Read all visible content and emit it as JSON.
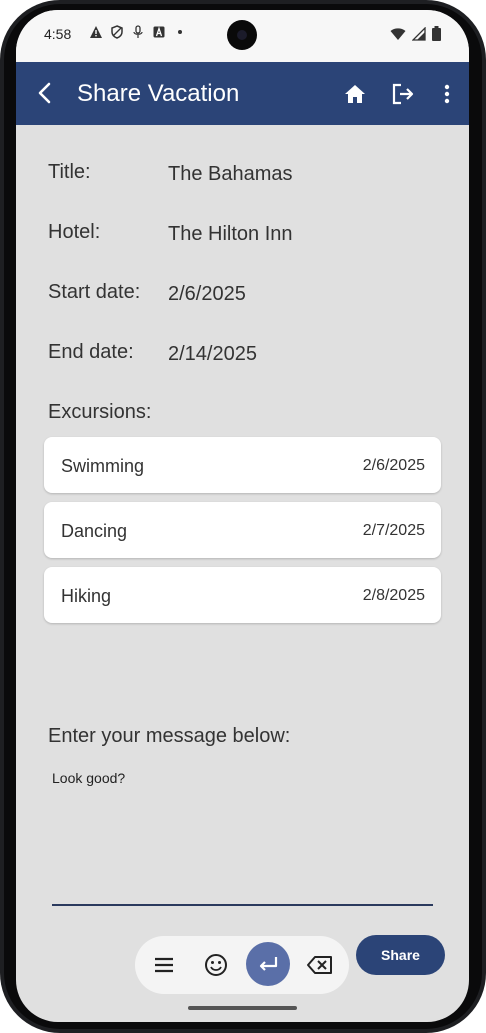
{
  "status_bar": {
    "time": "4:58",
    "left_icons": [
      "warning-icon",
      "shield-icon",
      "mic-icon",
      "a-box-icon",
      "dot-icon"
    ],
    "right_icons": [
      "wifi-icon",
      "signal-icon",
      "battery-icon"
    ]
  },
  "app_bar": {
    "title": "Share Vacation",
    "background": "#2b4477",
    "actions": [
      "home-icon",
      "logout-icon",
      "more-vert-icon"
    ]
  },
  "details": {
    "title_label": "Title:",
    "title_value": "The Bahamas",
    "hotel_label": "Hotel:",
    "hotel_value": "The Hilton Inn",
    "start_label": "Start date:",
    "start_value": "2/6/2025",
    "end_label": "End date:",
    "end_value": "2/14/2025"
  },
  "excursions": {
    "label": "Excursions:",
    "items": [
      {
        "name": "Swimming",
        "date": "2/6/2025"
      },
      {
        "name": "Dancing",
        "date": "2/7/2025"
      },
      {
        "name": "Hiking",
        "date": "2/8/2025"
      }
    ]
  },
  "message": {
    "label": "Enter your message below:",
    "value": "Look good?"
  },
  "keyboard_toolbar": {
    "buttons": [
      "menu-icon",
      "emoji-icon",
      "enter-icon",
      "backspace-icon"
    ]
  },
  "share_button": {
    "label": "Share"
  }
}
